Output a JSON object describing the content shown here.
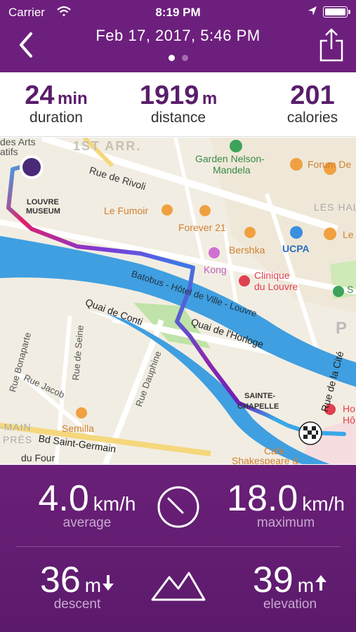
{
  "status_bar": {
    "carrier": "Carrier",
    "time": "8:19 PM"
  },
  "header": {
    "title": "Feb 17, 2017, 5:46 PM",
    "page_count": 2,
    "active_page": 0
  },
  "summary": {
    "duration": {
      "value": "24",
      "unit": "min",
      "label": "duration"
    },
    "distance": {
      "value": "1919",
      "unit": "m",
      "label": "distance"
    },
    "calories": {
      "value": "201",
      "unit": "",
      "label": "calories"
    }
  },
  "map": {
    "labels": {
      "arts": "des Arts",
      "latifs": "atifs",
      "first_arr": "1ST ARR.",
      "rivoli": "Rue de Rivoli",
      "garden": "Garden Nelson-",
      "mandela": "Mandela",
      "forum": "Forum De",
      "louvre1": "LOUVRE",
      "louvre2": "MUSEUM",
      "fumoir": "Le Fumoir",
      "forever": "Forever 21",
      "les_halles": "LES HALLES",
      "bershka": "Bershka",
      "ucpa": "UCPA",
      "kong": "Kong",
      "clinique1": "Clinique",
      "clinique2": "du Louvre",
      "batobus": "Batobus - Hôtel de Ville - Louvre",
      "conti": "Quai de Conti",
      "horloge": "Quai de l'Horloge",
      "bonaparte": "Rue Bonaparte",
      "seine": "Rue de Seine",
      "jacob": "Rue Jacob",
      "dauphine": "Rue Dauphine",
      "cite": "Rue de la Cité",
      "sainte1": "SAINTE-",
      "sainte2": "CHAPELLE",
      "semilla": "Semilla",
      "saint_germain": "Bd Saint-Germain",
      "main": "-MAIN",
      "pres": "PRÉS",
      "four": "du Four",
      "cafe": "Cafe",
      "shakespeare": "Shakespeare &",
      "ho1": "Ho",
      "ho2": "Hô",
      "le_lo": "Le Lo",
      "sq": "S",
      "p": "P"
    }
  },
  "speed": {
    "average": {
      "value": "4.0",
      "unit": "km/h",
      "label": "average"
    },
    "maximum": {
      "value": "18.0",
      "unit": "km/h",
      "label": "maximum"
    }
  },
  "elevation": {
    "descent": {
      "value": "36",
      "unit": "m",
      "label": "descent"
    },
    "elevation": {
      "value": "39",
      "unit": "m",
      "label": "elevation"
    }
  },
  "colors": {
    "header_purple": "#6d1f7d",
    "accent_purple": "#5a1d6b",
    "route_start": "#3aa8e8",
    "route_mid": "#e0206a",
    "route_end": "#6a1fb8",
    "water": "#3f9fe0"
  },
  "icons": {
    "back": "chevron-left-icon",
    "share": "share-icon",
    "speedometer": "speedometer-icon",
    "mountain": "mountain-icon",
    "arrow_down": "arrow-down-icon",
    "arrow_up": "arrow-up-icon",
    "start_marker": "route-start-icon",
    "finish_marker": "checkered-flag-icon"
  }
}
